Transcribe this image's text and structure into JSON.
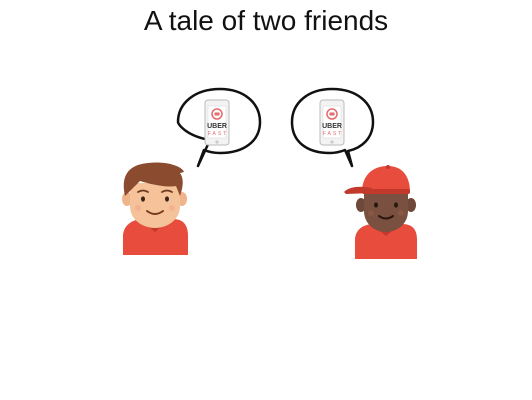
{
  "slide": {
    "title": "A tale of two friends"
  },
  "bubbles": [
    {
      "name": "left-friend-bubble",
      "phone": {
        "brand": "UBER",
        "sub": "FAST"
      }
    },
    {
      "name": "right-friend-bubble",
      "phone": {
        "brand": "UBER",
        "sub": "FAST"
      }
    }
  ],
  "characters": [
    {
      "name": "left-friend",
      "hair_color": "#8a4b2e",
      "skin_color": "#f5c29a",
      "shirt_color": "#e74c3c"
    },
    {
      "name": "right-friend",
      "cap_color": "#e74c3c",
      "skin_color": "#7a5140",
      "shirt_color": "#e74c3c"
    }
  ],
  "icons": {
    "phone": "phone-icon",
    "app_logo": "app-logo-icon"
  }
}
